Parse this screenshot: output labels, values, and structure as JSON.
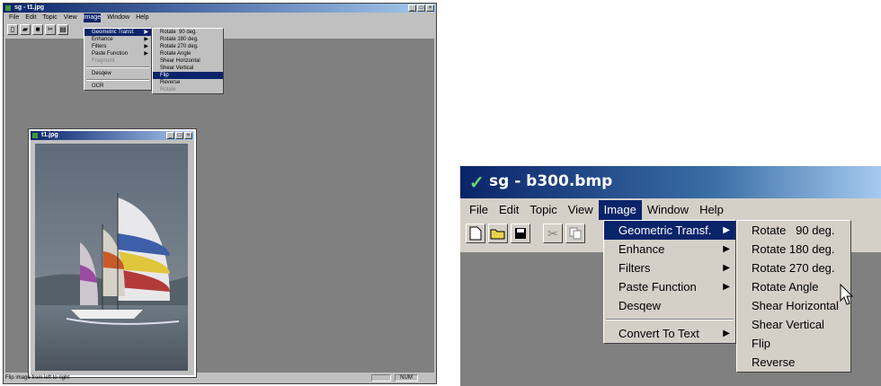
{
  "left": {
    "title": "sg - t1.jpg",
    "menubar": [
      "File",
      "Edit",
      "Topic",
      "View",
      "Image",
      "Window",
      "Help"
    ],
    "active_menu": "Image",
    "image_menu": [
      {
        "label": "Geometric Transf.",
        "submenu": true,
        "selected": true
      },
      {
        "label": "Enhance",
        "submenu": true
      },
      {
        "label": "Filters",
        "submenu": true
      },
      {
        "label": "Paste Function",
        "submenu": true
      },
      {
        "label": "Fragment",
        "disabled": true
      },
      {
        "label": "Desqew"
      },
      {
        "label": "OCR"
      }
    ],
    "geom_submenu": [
      {
        "label": "Rotate  90 deg."
      },
      {
        "label": "Rotate 180 deg."
      },
      {
        "label": "Rotate 270 deg."
      },
      {
        "label": "Rotate Angle"
      },
      {
        "label": "Shear Horizontal"
      },
      {
        "label": "Shear Vertical"
      },
      {
        "label": "Flip",
        "selected": true
      },
      {
        "label": "Reverse"
      },
      {
        "label": "Rotate",
        "disabled": true
      }
    ],
    "child_window_title": "t1.jpg",
    "status_text": "Flip image from left to right",
    "status_num": "NUM"
  },
  "right": {
    "title": "sg - b300.bmp",
    "menubar": [
      "File",
      "Edit",
      "Topic",
      "View",
      "Image",
      "Window",
      "Help"
    ],
    "active_menu": "Image",
    "image_menu": [
      {
        "label": "Geometric Transf.",
        "submenu": true,
        "selected": true
      },
      {
        "label": "Enhance",
        "submenu": true
      },
      {
        "label": "Filters",
        "submenu": true
      },
      {
        "label": "Paste Function",
        "submenu": true
      },
      {
        "label": "Desqew"
      },
      {
        "label": "Convert To Text",
        "submenu": true
      }
    ],
    "geom_submenu": [
      {
        "label": "Rotate   90 deg."
      },
      {
        "label": "Rotate 180 deg."
      },
      {
        "label": "Rotate 270 deg."
      },
      {
        "label": "Rotate Angle"
      },
      {
        "label": "Shear Horizontal"
      },
      {
        "label": "Shear Vertical"
      },
      {
        "label": "Flip"
      },
      {
        "label": "Reverse"
      }
    ]
  },
  "colors": {
    "selection": "#0a246a",
    "face": "#d4d0c8",
    "client": "#808080"
  }
}
